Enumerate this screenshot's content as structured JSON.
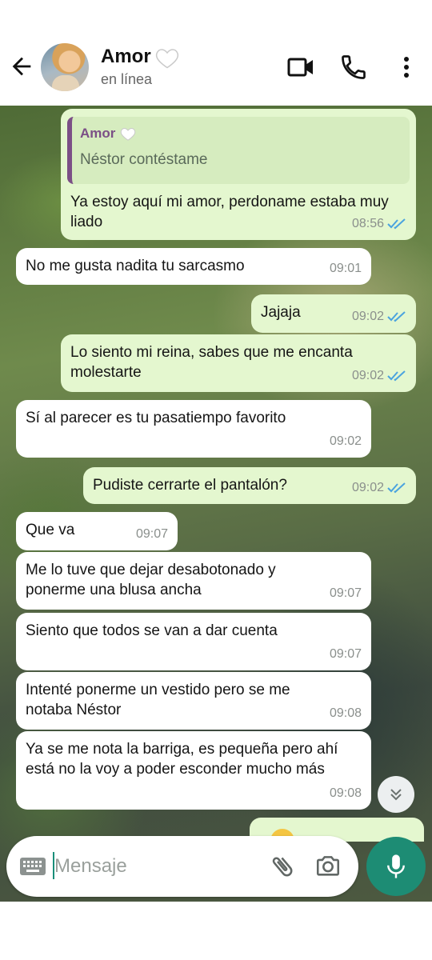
{
  "header": {
    "contact_name": "Amor",
    "status": "en línea",
    "icons": [
      "back-arrow-icon",
      "avatar",
      "white-heart-icon",
      "video-call-icon",
      "phone-icon",
      "more-vert-icon"
    ]
  },
  "messages": [
    {
      "direction": "out",
      "quote": {
        "author": "Amor",
        "text": "Néstor contéstame"
      },
      "text": "Ya estoy aquí mi amor, perdoname estaba muy liado",
      "time": "08:56",
      "read": true
    },
    {
      "direction": "in",
      "text": "No me gusta nadita tu sarcasmo",
      "time": "09:01"
    },
    {
      "direction": "out",
      "text": "Jajaja",
      "time": "09:02",
      "read": true
    },
    {
      "direction": "out",
      "text": "Lo siento mi reina, sabes que me encanta molestarte",
      "time": "09:02",
      "read": true
    },
    {
      "direction": "in",
      "text": "Sí al parecer es tu pasatiempo favorito",
      "time": "09:02"
    },
    {
      "direction": "out",
      "text": "Pudiste cerrarte el pantalón?",
      "time": "09:02",
      "read": true
    },
    {
      "direction": "in",
      "text": "Que va",
      "time": "09:07"
    },
    {
      "direction": "in",
      "text": "Me lo tuve que dejar desabotonado y ponerme una blusa ancha",
      "time": "09:07"
    },
    {
      "direction": "in",
      "text": "Siento que todos se van a dar cuenta",
      "time": "09:07"
    },
    {
      "direction": "in",
      "text": "Intenté ponerme un vestido pero se me notaba Néstor",
      "time": "09:08"
    },
    {
      "direction": "in",
      "text": "Ya se me nota la barriga, es pequeña pero ahí está no la voy a poder esconder mucho más",
      "time": "09:08"
    }
  ],
  "composer": {
    "placeholder": "Mensaje",
    "value": ""
  },
  "colors": {
    "outgoing_bubble": "#e4f7cf",
    "incoming_bubble": "#ffffff",
    "read_ticks": "#4aa3df",
    "quote_accent": "#7b4f86",
    "mic_button": "#1d8c74"
  }
}
